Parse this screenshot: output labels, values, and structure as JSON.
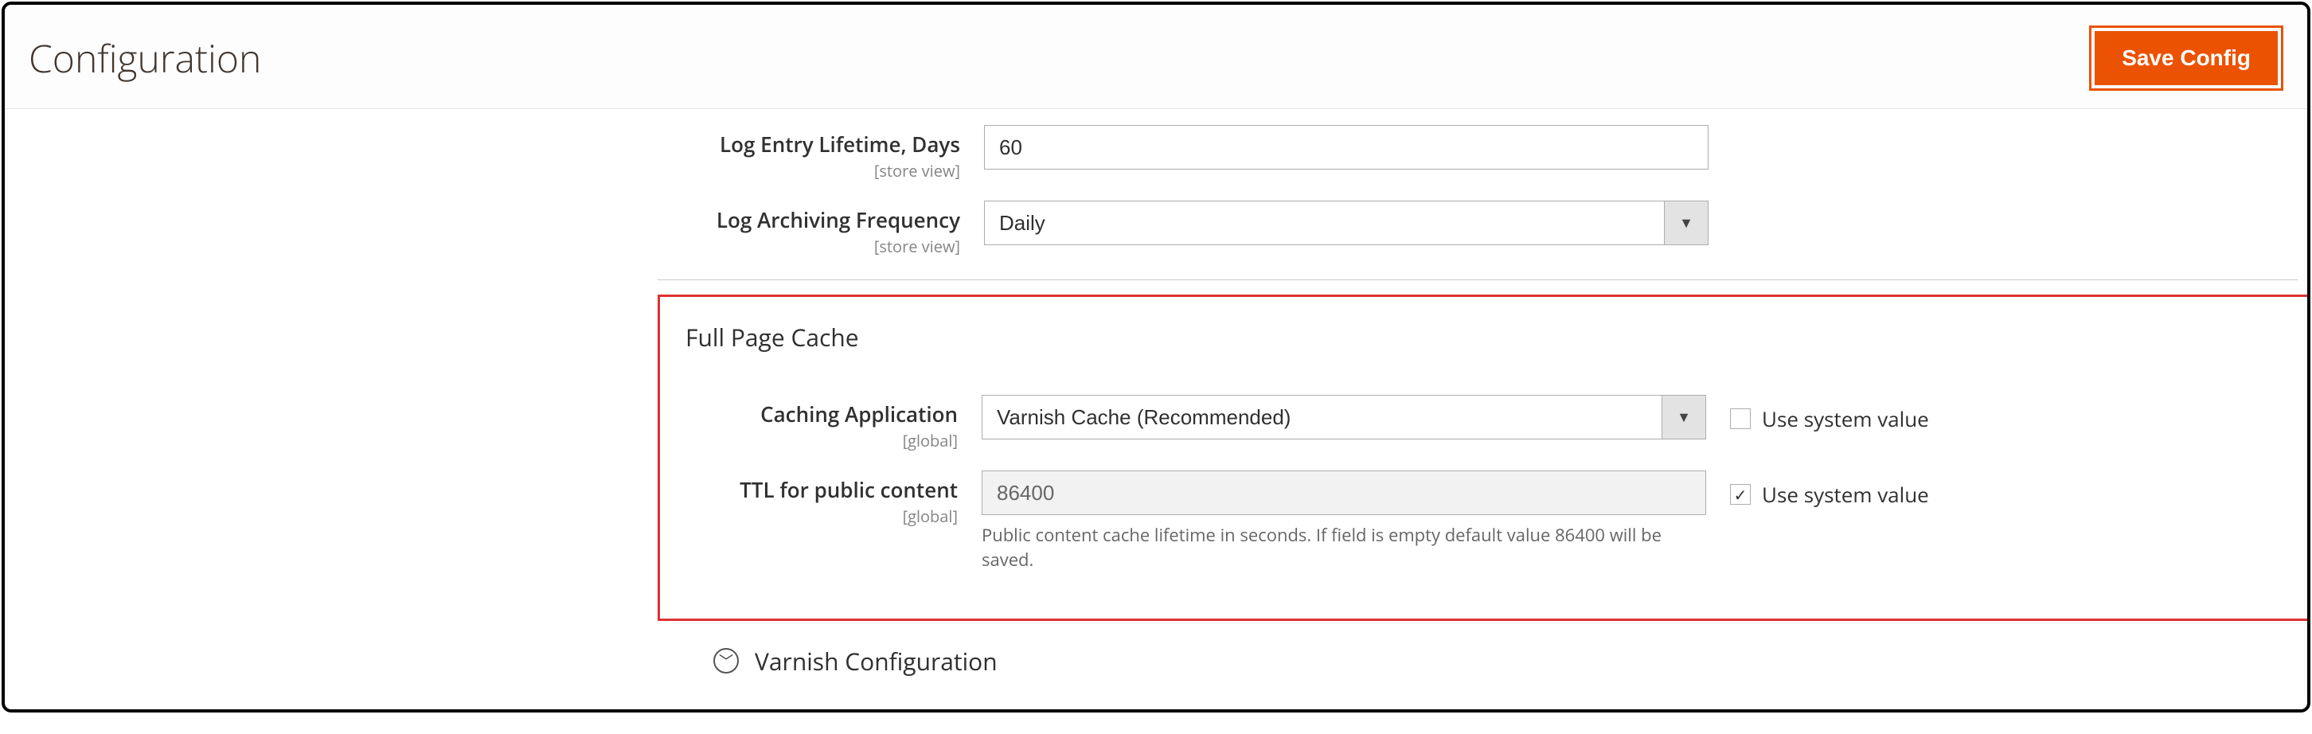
{
  "header": {
    "title": "Configuration",
    "save_label": "Save Config"
  },
  "fields": {
    "log_lifetime": {
      "label": "Log Entry Lifetime, Days",
      "scope": "[store view]",
      "value": "60"
    },
    "log_frequency": {
      "label": "Log Archiving Frequency",
      "scope": "[store view]",
      "value": "Daily"
    }
  },
  "section": {
    "title": "Full Page Cache",
    "caching_app": {
      "label": "Caching Application",
      "scope": "[global]",
      "value": "Varnish Cache (Recommended)",
      "use_system_label": "Use system value",
      "use_system_checked": false
    },
    "ttl": {
      "label": "TTL for public content",
      "scope": "[global]",
      "value": "86400",
      "hint": "Public content cache lifetime in seconds. If field is empty default value 86400 will be saved.",
      "use_system_label": "Use system value",
      "use_system_checked": true
    }
  },
  "subsection": {
    "title": "Varnish Configuration"
  }
}
